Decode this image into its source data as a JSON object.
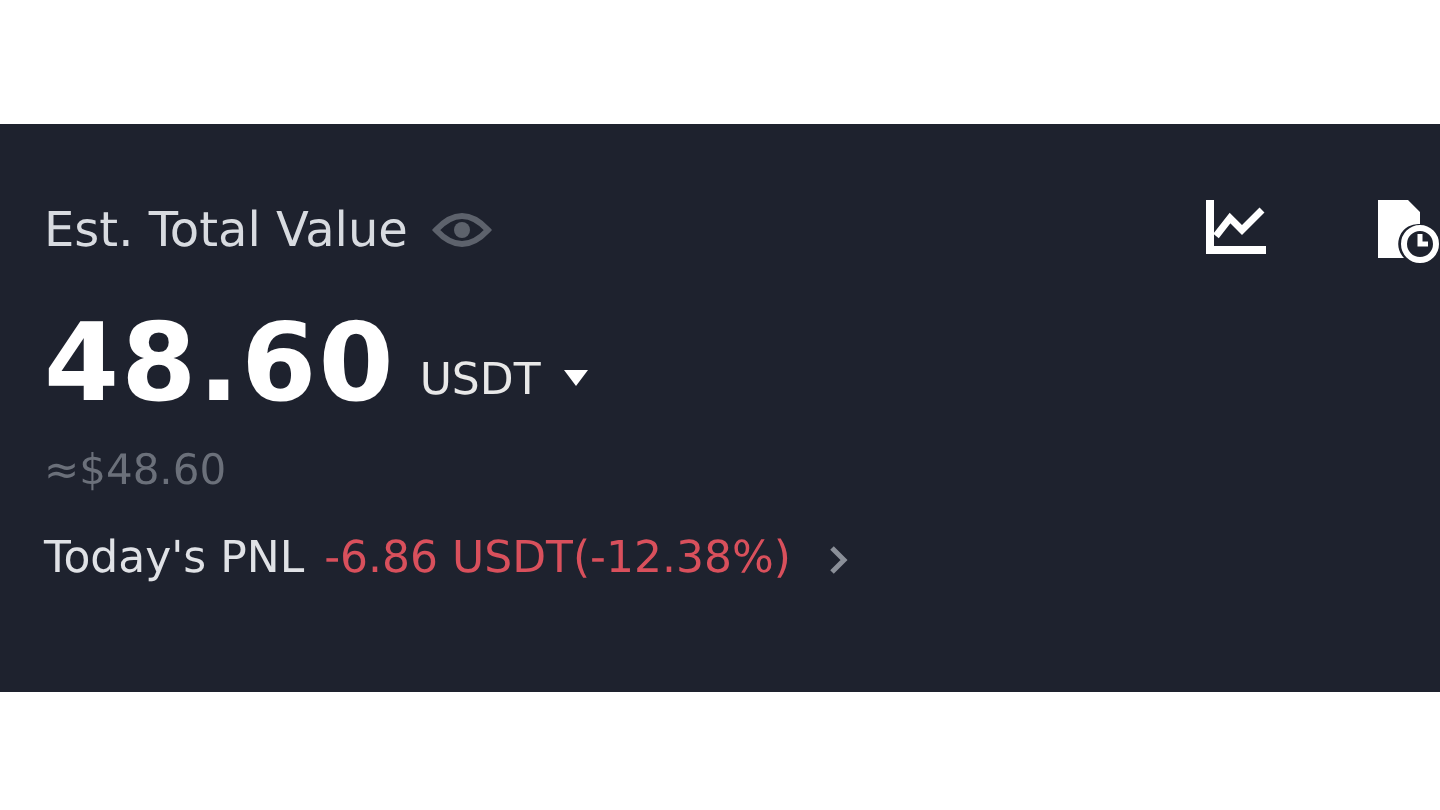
{
  "header": {
    "title": "Est. Total Value"
  },
  "balance": {
    "amount": "48.60",
    "currency": "USDT",
    "fiat_estimate": "≈$48.60"
  },
  "pnl": {
    "label": "Today's PNL",
    "value": "-6.86 USDT(-12.38%)"
  }
}
